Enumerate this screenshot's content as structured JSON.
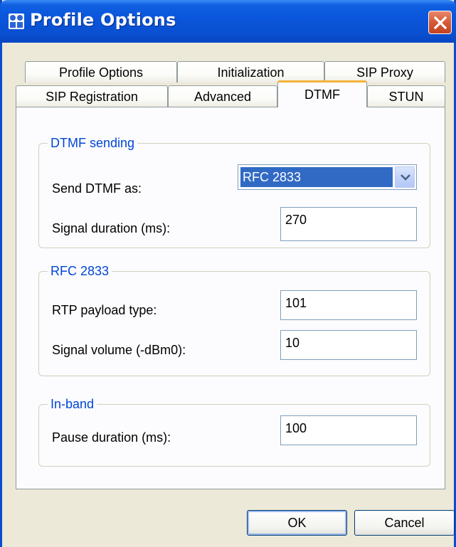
{
  "window": {
    "title": "Profile Options",
    "app_icon": "profile-app-icon",
    "close_icon": "close-icon"
  },
  "tabs": {
    "row_top": [
      "Profile Options",
      "Initialization",
      "SIP Proxy"
    ],
    "row_bottom": [
      "SIP Registration",
      "Advanced",
      "DTMF",
      "STUN"
    ],
    "active": "DTMF"
  },
  "dtmf_sending": {
    "title": "DTMF sending",
    "send_as_label": "Send DTMF as:",
    "send_as_value": "RFC 2833",
    "signal_duration_label": "Signal duration (ms):",
    "signal_duration_value": "270"
  },
  "rfc2833": {
    "title": "RFC 2833",
    "payload_label": "RTP payload type:",
    "payload_value": "101",
    "volume_label": "Signal volume (-dBm0):",
    "volume_value": "10"
  },
  "inband": {
    "title": "In-band",
    "pause_label": "Pause duration (ms):",
    "pause_value": "100"
  },
  "buttons": {
    "ok": "OK",
    "cancel": "Cancel"
  },
  "colors": {
    "titlebar": "#0a56dc",
    "group_title": "#0046d5",
    "selection": "#316ac5",
    "active_tab_accent": "#f5b13a"
  }
}
